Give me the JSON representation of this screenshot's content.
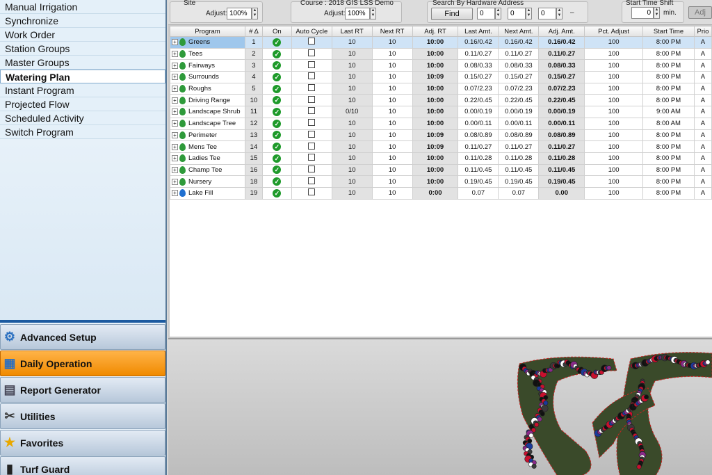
{
  "sidebar": {
    "items": [
      {
        "label": "Manual Irrigation"
      },
      {
        "label": "Synchronize"
      },
      {
        "label": "Work Order"
      },
      {
        "label": "Station Groups"
      },
      {
        "label": "Master Groups"
      },
      {
        "label": "Watering Plan"
      },
      {
        "label": "Instant Program"
      },
      {
        "label": "Projected Flow"
      },
      {
        "label": "Scheduled Activity"
      },
      {
        "label": "Switch Program"
      }
    ],
    "active_item": "Watering Plan"
  },
  "nav": {
    "buttons": [
      {
        "label": "Advanced Setup",
        "icon": "gear-icon"
      },
      {
        "label": "Daily Operation",
        "icon": "calendar-icon"
      },
      {
        "label": "Report Generator",
        "icon": "report-icon"
      },
      {
        "label": "Utilities",
        "icon": "tools-icon"
      },
      {
        "label": "Favorites",
        "icon": "star-icon"
      },
      {
        "label": "Turf Guard",
        "icon": "sensor-icon"
      }
    ],
    "active": "Daily Operation"
  },
  "toolbar": {
    "site_label": "Site",
    "site_adjust_label": "Adjust:",
    "site_adjust_value": "100%",
    "course_label": "Course : 2018 GIS LSS Demo",
    "course_adjust_label": "Adjust:",
    "course_adjust_value": "100%",
    "search_label": "Search By Hardware Address",
    "find_label": "Find",
    "addr1": "0",
    "addr2": "0",
    "addr3": "0",
    "dash": "–",
    "shift_label": "Start Time Shift",
    "shift_value": "0",
    "shift_unit": "min.",
    "adj_button": "Adj"
  },
  "table": {
    "headers": [
      "Program",
      "# Δ",
      "On",
      "Auto Cycle",
      "Last RT",
      "Next RT",
      "Adj. RT",
      "Last Amt.",
      "Next Amt.",
      "Adj. Amt.",
      "Pct. Adjust",
      "Start Time",
      "Prio"
    ],
    "rows": [
      {
        "program": "Greens",
        "num": "1",
        "last_rt": "10",
        "next_rt": "10",
        "adj_rt": "10:00",
        "last_amt": "0.16/0.42",
        "next_amt": "0.16/0.42",
        "adj_amt": "0.16/0.42",
        "pct": "100",
        "start": "8:00 PM",
        "prio": "A",
        "drop": "#2e9a3a"
      },
      {
        "program": "Tees",
        "num": "2",
        "last_rt": "10",
        "next_rt": "10",
        "adj_rt": "10:00",
        "last_amt": "0.11/0.27",
        "next_amt": "0.11/0.27",
        "adj_amt": "0.11/0.27",
        "pct": "100",
        "start": "8:00 PM",
        "prio": "A",
        "drop": "#2e9a3a"
      },
      {
        "program": "Fairways",
        "num": "3",
        "last_rt": "10",
        "next_rt": "10",
        "adj_rt": "10:00",
        "last_amt": "0.08/0.33",
        "next_amt": "0.08/0.33",
        "adj_amt": "0.08/0.33",
        "pct": "100",
        "start": "8:00 PM",
        "prio": "A",
        "drop": "#2e9a3a"
      },
      {
        "program": "Surrounds",
        "num": "4",
        "last_rt": "10",
        "next_rt": "10",
        "adj_rt": "10:09",
        "last_amt": "0.15/0.27",
        "next_amt": "0.15/0.27",
        "adj_amt": "0.15/0.27",
        "pct": "100",
        "start": "8:00 PM",
        "prio": "A",
        "drop": "#2e9a3a"
      },
      {
        "program": "Roughs",
        "num": "5",
        "last_rt": "10",
        "next_rt": "10",
        "adj_rt": "10:00",
        "last_amt": "0.07/2.23",
        "next_amt": "0.07/2.23",
        "adj_amt": "0.07/2.23",
        "pct": "100",
        "start": "8:00 PM",
        "prio": "A",
        "drop": "#2e9a3a"
      },
      {
        "program": "Driving Range",
        "num": "10",
        "last_rt": "10",
        "next_rt": "10",
        "adj_rt": "10:00",
        "last_amt": "0.22/0.45",
        "next_amt": "0.22/0.45",
        "adj_amt": "0.22/0.45",
        "pct": "100",
        "start": "8:00 PM",
        "prio": "A",
        "drop": "#2e9a3a"
      },
      {
        "program": "Landscape Shrub",
        "num": "11",
        "last_rt": "0/10",
        "next_rt": "10",
        "adj_rt": "10:00",
        "last_amt": "0.00/0.19",
        "next_amt": "0.00/0.19",
        "adj_amt": "0.00/0.19",
        "pct": "100",
        "start": "9:00 AM",
        "prio": "A",
        "drop": "#2e9a3a"
      },
      {
        "program": "Landscape Tree",
        "num": "12",
        "last_rt": "10",
        "next_rt": "10",
        "adj_rt": "10:00",
        "last_amt": "0.00/0.11",
        "next_amt": "0.00/0.11",
        "adj_amt": "0.00/0.11",
        "pct": "100",
        "start": "8:00 AM",
        "prio": "A",
        "drop": "#2e9a3a"
      },
      {
        "program": "Perimeter",
        "num": "13",
        "last_rt": "10",
        "next_rt": "10",
        "adj_rt": "10:09",
        "last_amt": "0.08/0.89",
        "next_amt": "0.08/0.89",
        "adj_amt": "0.08/0.89",
        "pct": "100",
        "start": "8:00 PM",
        "prio": "A",
        "drop": "#2e9a3a"
      },
      {
        "program": "Mens Tee",
        "num": "14",
        "last_rt": "10",
        "next_rt": "10",
        "adj_rt": "10:09",
        "last_amt": "0.11/0.27",
        "next_amt": "0.11/0.27",
        "adj_amt": "0.11/0.27",
        "pct": "100",
        "start": "8:00 PM",
        "prio": "A",
        "drop": "#2e9a3a"
      },
      {
        "program": "Ladies Tee",
        "num": "15",
        "last_rt": "10",
        "next_rt": "10",
        "adj_rt": "10:00",
        "last_amt": "0.11/0.28",
        "next_amt": "0.11/0.28",
        "adj_amt": "0.11/0.28",
        "pct": "100",
        "start": "8:00 PM",
        "prio": "A",
        "drop": "#2e9a3a"
      },
      {
        "program": "Champ Tee",
        "num": "16",
        "last_rt": "10",
        "next_rt": "10",
        "adj_rt": "10:00",
        "last_amt": "0.11/0.45",
        "next_amt": "0.11/0.45",
        "adj_amt": "0.11/0.45",
        "pct": "100",
        "start": "8:00 PM",
        "prio": "A",
        "drop": "#2e9a3a"
      },
      {
        "program": "Nursery",
        "num": "18",
        "last_rt": "10",
        "next_rt": "10",
        "adj_rt": "10:00",
        "last_amt": "0.19/0.45",
        "next_amt": "0.19/0.45",
        "adj_amt": "0.19/0.45",
        "pct": "100",
        "start": "8:00 PM",
        "prio": "A",
        "drop": "#2e9a3a"
      },
      {
        "program": "Lake Fill",
        "num": "19",
        "last_rt": "10",
        "next_rt": "10",
        "adj_rt": "0:00",
        "last_amt": "0.07",
        "next_amt": "0.07",
        "adj_amt": "0.00",
        "pct": "100",
        "start": "8:00 PM",
        "prio": "A",
        "drop": "#1f6fd0"
      }
    ],
    "selected_row": 0
  },
  "colors": {
    "active_nav": "#f08a00",
    "sidebar_accent": "#1c5aa0",
    "check_green": "#1e9a2a"
  }
}
